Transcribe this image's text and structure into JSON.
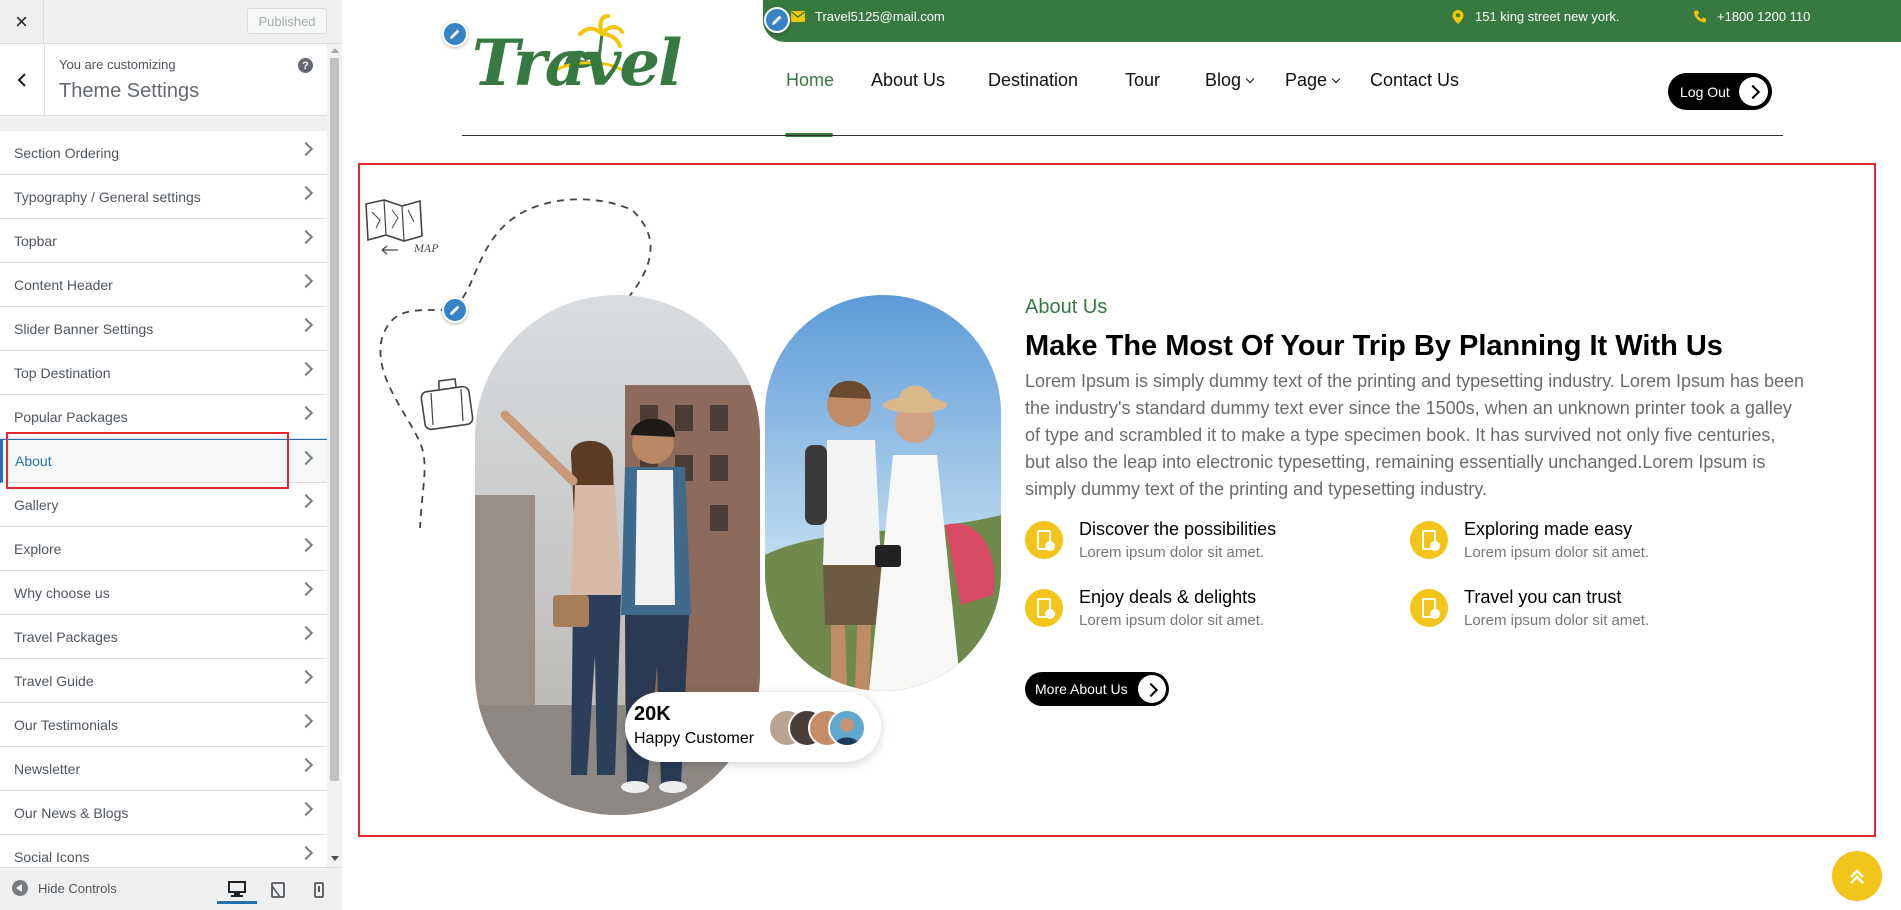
{
  "customizer": {
    "close_label": "×",
    "published_label": "Published",
    "customizing_label": "You are customizing",
    "panel_title": "Theme Settings",
    "help_label": "?",
    "sections": [
      {
        "label": "Section Ordering"
      },
      {
        "label": "Typography / General settings"
      },
      {
        "label": "Topbar"
      },
      {
        "label": "Content Header"
      },
      {
        "label": "Slider Banner Settings"
      },
      {
        "label": "Top Destination"
      },
      {
        "label": "Popular Packages"
      },
      {
        "label": "About",
        "active": true
      },
      {
        "label": "Gallery"
      },
      {
        "label": "Explore"
      },
      {
        "label": "Why choose us"
      },
      {
        "label": "Travel Packages"
      },
      {
        "label": "Travel Guide"
      },
      {
        "label": "Our Testimonials"
      },
      {
        "label": "Newsletter"
      },
      {
        "label": "Our News & Blogs"
      },
      {
        "label": "Social Icons"
      }
    ],
    "hide_controls_label": "Hide Controls",
    "active_device": "desktop"
  },
  "site": {
    "logo_text": "Travel",
    "brand_color": "#367941",
    "accent_color": "#f3c51a",
    "topbar": {
      "email": "Travel5125@mail.com",
      "address": "151 king street new york.",
      "phone": "+1800 1200 110",
      "social_icons": [
        "facebook-icon",
        "twitter-icon",
        "instagram-icon",
        "youtube-icon"
      ]
    },
    "nav": {
      "items": [
        {
          "label": "Home",
          "active": true
        },
        {
          "label": "About Us"
        },
        {
          "label": "Destination"
        },
        {
          "label": "Tour"
        },
        {
          "label": "Blog",
          "dropdown": true
        },
        {
          "label": "Page",
          "dropdown": true
        },
        {
          "label": "Contact Us"
        }
      ],
      "logout_label": "Log Out"
    }
  },
  "about": {
    "map_label": "MAP",
    "eyebrow": "About Us",
    "title": "Make The Most Of Your Trip By Planning It With Us",
    "description": "Lorem Ipsum is simply dummy text of the printing and typesetting industry. Lorem Ipsum has been the industry's standard dummy text ever since the 1500s, when an unknown printer took a galley of type and scrambled it to make a type specimen book. It has survived not only five centuries, but also the leap into electronic typesetting, remaining essentially unchanged.Lorem Ipsum is simply dummy text of the printing and typesetting industry.",
    "features": [
      {
        "title": "Discover the possibilities",
        "desc": "Lorem ipsum dolor sit amet."
      },
      {
        "title": "Exploring made easy",
        "desc": "Lorem ipsum dolor sit amet."
      },
      {
        "title": "Enjoy deals & delights",
        "desc": "Lorem ipsum dolor sit amet."
      },
      {
        "title": "Travel you can trust",
        "desc": "Lorem ipsum dolor sit amet."
      }
    ],
    "more_button_label": "More About Us",
    "happy_count": "20K",
    "happy_label": "Happy Customer"
  }
}
